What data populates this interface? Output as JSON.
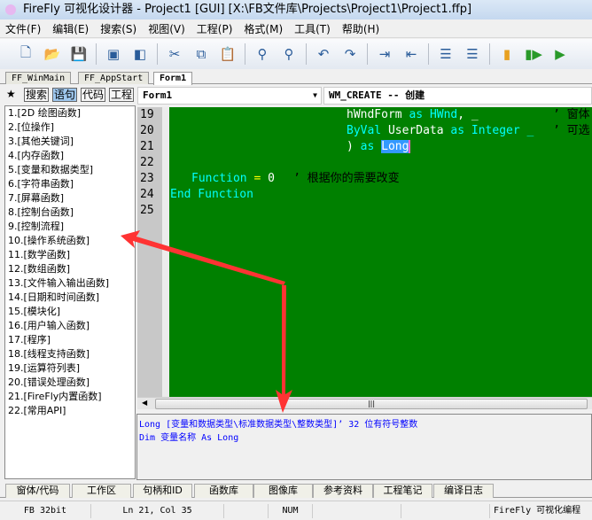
{
  "window": {
    "title": "FireFly 可视化设计器 - Project1 [GUI]  [X:\\FB文件库\\Projects\\Project1\\Project1.ffp]"
  },
  "menu": [
    "文件(F)",
    "编辑(E)",
    "搜索(S)",
    "视图(V)",
    "工程(P)",
    "格式(M)",
    "工具(T)",
    "帮助(H)"
  ],
  "file_tabs": [
    "FF_WinMain",
    "FF_AppStart",
    "Form1"
  ],
  "side_buttons": {
    "star": "★",
    "search": "搜索",
    "statement": "语句",
    "code": "代码",
    "project": "工程"
  },
  "combos": {
    "form": "Form1",
    "event": "WM_CREATE -- 创建"
  },
  "categories": [
    "1.[2D 绘图函数]",
    "2.[位操作]",
    "3.[其他关键词]",
    "4.[内存函数]",
    "5.[变量和数据类型]",
    "6.[字符串函数]",
    "7.[屏幕函数]",
    "8.[控制台函数]",
    "9.[控制流程]",
    "10.[操作系统函数]",
    "11.[数学函数]",
    "12.[数组函数]",
    "13.[文件输入输出函数]",
    "14.[日期和时间函数]",
    "15.[模块化]",
    "16.[用户输入函数]",
    "17.[程序]",
    "18.[线程支持函数]",
    "19.[运算符列表]",
    "20.[错误处理函数]",
    "21.[FireFly内置函数]",
    "22.[常用API]"
  ],
  "line_numbers": [
    "19",
    "20",
    "21",
    "22",
    "23",
    "24",
    "25"
  ],
  "code": {
    "l19": {
      "a": "hWndForm",
      "b": " as ",
      "c": "HWnd",
      "d": ", _",
      "cm": "’ 窗体"
    },
    "l20": {
      "a": "ByVal",
      "b": " UserData ",
      "c": "as",
      "d": " Integer _",
      "cm": "’ 可选"
    },
    "l21": {
      "a": ") ",
      "b": "as ",
      "sel": "Long"
    },
    "l23": {
      "a": "Function",
      "b": " = ",
      "c": "0",
      "cm": "’ 根据你的需要改变"
    },
    "l24": {
      "a": "End Function"
    }
  },
  "output": {
    "line1": "Long [变量和数据类型\\标准数据类型\\整数类型]’    32 位有符号整数",
    "line2": "Dim 变量名称 As Long"
  },
  "bottom_tabs": [
    "窗体/代码",
    "工作区",
    "句柄和ID",
    "函数库",
    "图像库",
    "参考资料",
    "工程笔记",
    "编译日志"
  ],
  "status": {
    "bits": "FB 32bit",
    "pos": "Ln 21,  Col 35",
    "num": "NUM",
    "app": "FireFly 可视化编程"
  },
  "colors": {
    "editor_bg": "#008000",
    "keyword": "#00ffff",
    "arrow": "#ff3333"
  }
}
